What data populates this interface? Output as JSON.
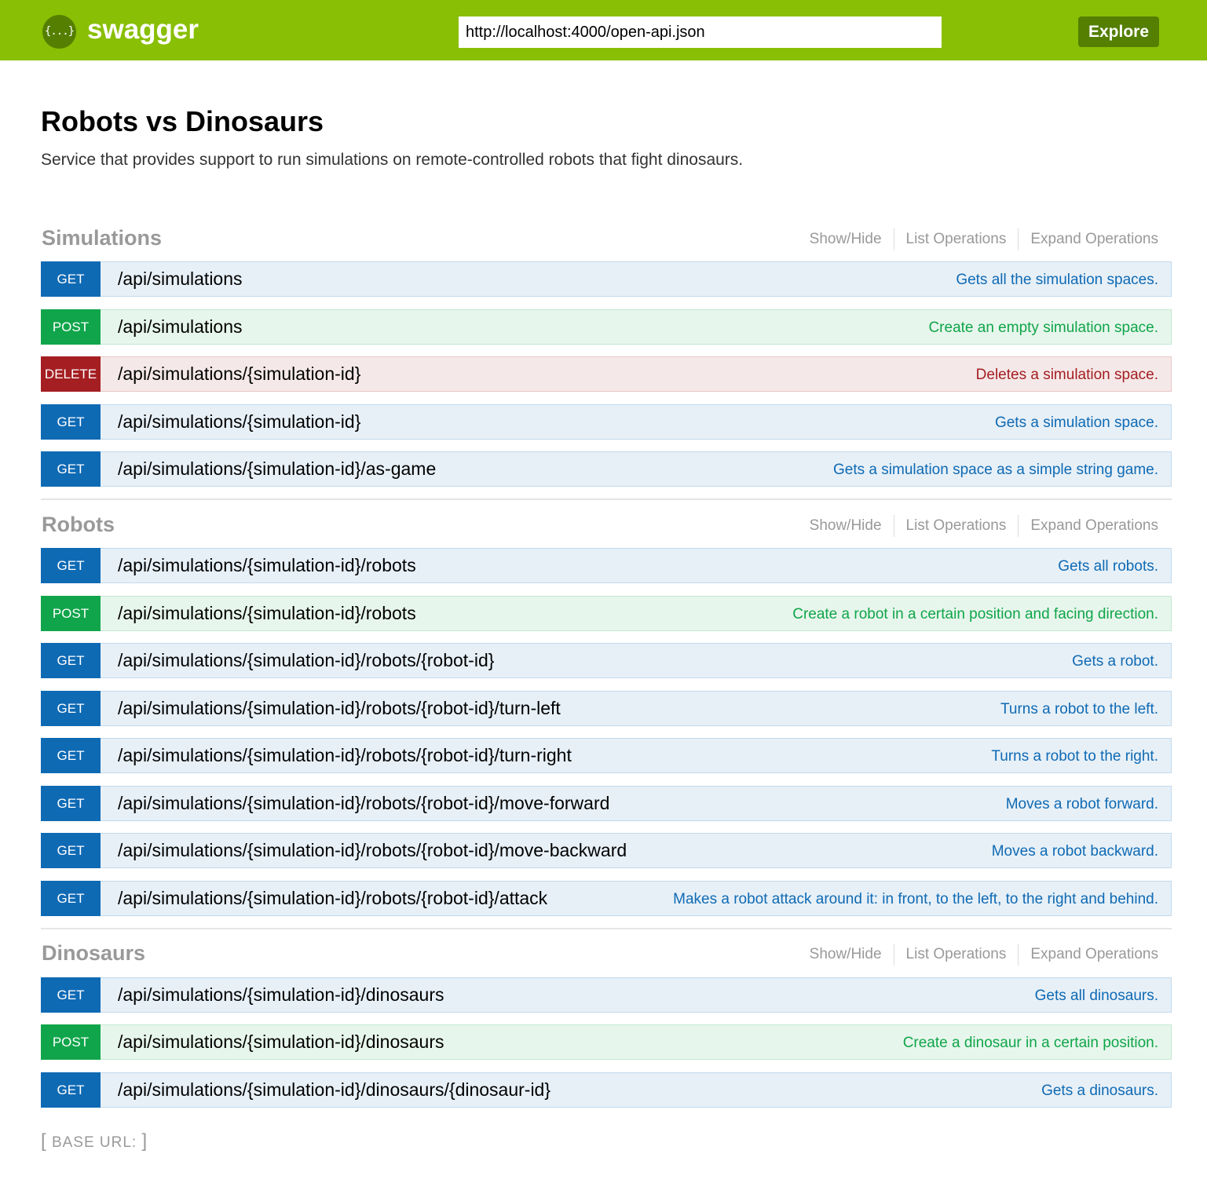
{
  "header": {
    "logo_glyph": "{...}",
    "logo_text": "swagger",
    "url_value": "http://localhost:4000/open-api.json",
    "explore_label": "Explore",
    "brand_color": "#89bf04",
    "dark_color": "#547f00"
  },
  "info": {
    "title": "Robots vs Dinosaurs",
    "description": "Service that provides support to run simulations on remote-controlled robots that fight dinosaurs."
  },
  "resource_links": {
    "show_hide": "Show/Hide",
    "list_operations": "List Operations",
    "expand_operations": "Expand Operations"
  },
  "resources": [
    {
      "name": "Simulations",
      "operations": [
        {
          "method": "GET",
          "path": "/api/simulations",
          "summary": "Gets all the simulation spaces."
        },
        {
          "method": "POST",
          "path": "/api/simulations",
          "summary": "Create an empty simulation space."
        },
        {
          "method": "DELETE",
          "path": "/api/simulations/{simulation-id}",
          "summary": "Deletes a simulation space."
        },
        {
          "method": "GET",
          "path": "/api/simulations/{simulation-id}",
          "summary": "Gets a simulation space."
        },
        {
          "method": "GET",
          "path": "/api/simulations/{simulation-id}/as-game",
          "summary": "Gets a simulation space as a simple string game."
        }
      ]
    },
    {
      "name": "Robots",
      "operations": [
        {
          "method": "GET",
          "path": "/api/simulations/{simulation-id}/robots",
          "summary": "Gets all robots."
        },
        {
          "method": "POST",
          "path": "/api/simulations/{simulation-id}/robots",
          "summary": "Create a robot in a certain position and facing direction."
        },
        {
          "method": "GET",
          "path": "/api/simulations/{simulation-id}/robots/{robot-id}",
          "summary": "Gets a robot."
        },
        {
          "method": "GET",
          "path": "/api/simulations/{simulation-id}/robots/{robot-id}/turn-left",
          "summary": "Turns a robot to the left."
        },
        {
          "method": "GET",
          "path": "/api/simulations/{simulation-id}/robots/{robot-id}/turn-right",
          "summary": "Turns a robot to the right."
        },
        {
          "method": "GET",
          "path": "/api/simulations/{simulation-id}/robots/{robot-id}/move-forward",
          "summary": "Moves a robot forward."
        },
        {
          "method": "GET",
          "path": "/api/simulations/{simulation-id}/robots/{robot-id}/move-backward",
          "summary": "Moves a robot backward."
        },
        {
          "method": "GET",
          "path": "/api/simulations/{simulation-id}/robots/{robot-id}/attack",
          "summary": "Makes a robot attack around it: in front, to the left, to the right and behind."
        }
      ]
    },
    {
      "name": "Dinosaurs",
      "operations": [
        {
          "method": "GET",
          "path": "/api/simulations/{simulation-id}/dinosaurs",
          "summary": "Gets all dinosaurs."
        },
        {
          "method": "POST",
          "path": "/api/simulations/{simulation-id}/dinosaurs",
          "summary": "Create a dinosaur in a certain position."
        },
        {
          "method": "GET",
          "path": "/api/simulations/{simulation-id}/dinosaurs/{dinosaur-id}",
          "summary": "Gets a dinosaurs."
        }
      ]
    }
  ],
  "footer": {
    "open_bracket": "[",
    "base_url_label": "BASE URL:",
    "close_bracket": "]"
  },
  "method_colors": {
    "GET": "#0f6ab4",
    "POST": "#10a54a",
    "DELETE": "#a41e22"
  }
}
